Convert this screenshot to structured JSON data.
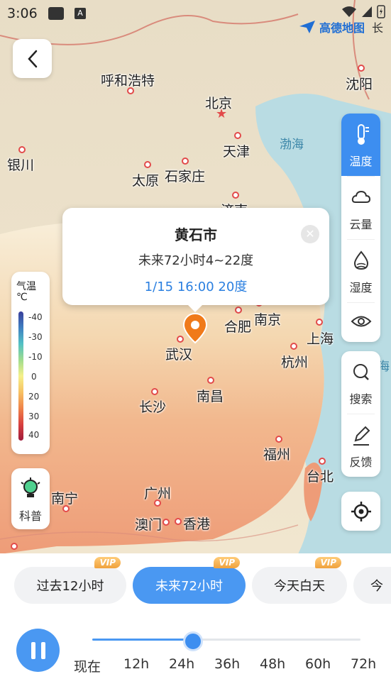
{
  "status_bar": {
    "time": "3:06",
    "notif_icon": "A"
  },
  "brand": {
    "name": "高德地图",
    "clip": "长"
  },
  "map": {
    "cities": [
      {
        "name": "呼和浩特",
        "dot": true
      },
      {
        "name": "北京",
        "capital": true
      },
      {
        "name": "沈阳",
        "dot": true
      },
      {
        "name": "银川",
        "dot": true
      },
      {
        "name": "天津",
        "dot": true
      },
      {
        "name": "太原",
        "dot": true
      },
      {
        "name": "石家庄",
        "dot": true
      },
      {
        "name": "济南",
        "dot": true
      },
      {
        "name": "合肥",
        "dot": true
      },
      {
        "name": "南京",
        "dot": true
      },
      {
        "name": "上海",
        "dot": true
      },
      {
        "name": "武汉",
        "dot": true
      },
      {
        "name": "杭州",
        "dot": true
      },
      {
        "name": "南昌",
        "dot": true
      },
      {
        "name": "长沙",
        "dot": true
      },
      {
        "name": "福州",
        "dot": true
      },
      {
        "name": "台北",
        "dot": true
      },
      {
        "name": "广州",
        "dot": true
      },
      {
        "name": "南宁",
        "dot": true
      },
      {
        "name": "澳门",
        "dot": true
      },
      {
        "name": "香港",
        "dot": true
      }
    ],
    "seas": [
      "渤海",
      "海"
    ]
  },
  "popup": {
    "title": "黄石市",
    "summary": "未来72小时4~22度",
    "current": "1/15 16:00 20度"
  },
  "legend": {
    "title_line1": "气温",
    "title_line2": "℃",
    "ticks": [
      "-40",
      "-30",
      "-10",
      "0",
      "20",
      "30",
      "40"
    ]
  },
  "kepu": {
    "label": "科普"
  },
  "layers": [
    {
      "label": "温度",
      "icon": "thermometer-icon",
      "active": true
    },
    {
      "label": "云量",
      "icon": "cloud-icon",
      "active": false
    },
    {
      "label": "湿度",
      "icon": "humidity-icon",
      "active": false
    },
    {
      "label": "",
      "icon": "eye-icon",
      "active": false
    }
  ],
  "tools": [
    {
      "label": "搜索",
      "icon": "search-icon"
    },
    {
      "label": "反馈",
      "icon": "pencil-icon"
    }
  ],
  "time_tabs": [
    {
      "label": "过去12小时",
      "vip": "VIP",
      "active": false
    },
    {
      "label": "未来72小时",
      "vip": "VIP",
      "active": true
    },
    {
      "label": "今天白天",
      "vip": "VIP",
      "active": false
    },
    {
      "label": "今",
      "vip": "",
      "active": false
    }
  ],
  "timeline": {
    "labels": [
      "现在",
      "12h",
      "24h",
      "36h",
      "48h",
      "60h",
      "72h"
    ],
    "progress": 0.375
  },
  "colors": {
    "accent": "#4a98f2",
    "vip": "#f0a23d",
    "dot": "#e24a4a"
  }
}
